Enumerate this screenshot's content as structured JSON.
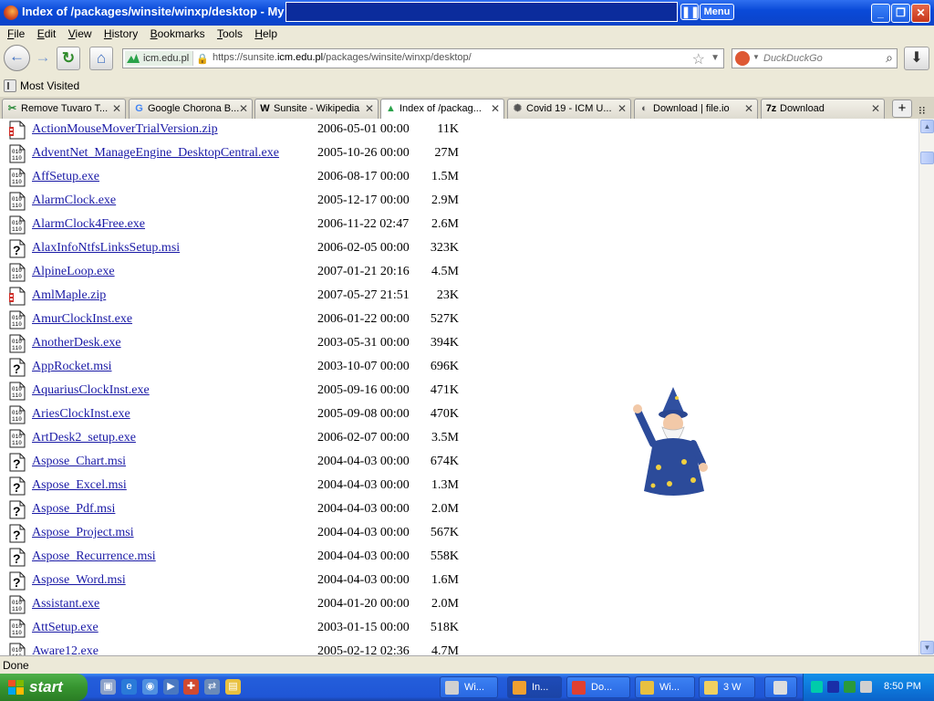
{
  "window": {
    "title": "Index of /packages/winsite/winxp/desktop - My",
    "pause_symbol": "❚❚",
    "menu_button": "Menu",
    "min": "_",
    "max": "❐",
    "close": "✕"
  },
  "menubar": [
    "File",
    "Edit",
    "View",
    "History",
    "Bookmarks",
    "Tools",
    "Help"
  ],
  "nav": {
    "back": "←",
    "forward": "→",
    "reload": "↻",
    "home": "⌂",
    "site_badge": "icm.edu.pl",
    "url_prefix": "https://sunsite.",
    "url_domain": "icm.edu.pl",
    "url_path": "/packages/winsite/winxp/desktop/",
    "search_placeholder": "DuckDuckGo",
    "download": "⬇"
  },
  "bookmarks": {
    "most_visited": "Most Visited"
  },
  "tabs": [
    {
      "label": "Remove Tuvaro T...",
      "icon": "tuvaro-icon",
      "icon_glyph": "✂",
      "icon_color": "#2a8a3a",
      "active": false
    },
    {
      "label": "Google Chorona B...",
      "icon": "google-icon",
      "icon_glyph": "G",
      "icon_color": "#4285f4",
      "active": false
    },
    {
      "label": "Sunsite - Wikipedia",
      "icon": "wikipedia-icon",
      "icon_glyph": "W",
      "icon_color": "#000000",
      "active": false
    },
    {
      "label": "Index of /packag...",
      "icon": "icm-icon",
      "icon_glyph": "▲",
      "icon_color": "#2aa24a",
      "active": true
    },
    {
      "label": "Covid 19 - ICM U...",
      "icon": "covid-icon",
      "icon_glyph": "✺",
      "icon_color": "#555555",
      "active": false
    },
    {
      "label": "Download | file.io",
      "icon": "fileio-icon",
      "icon_glyph": "◐",
      "icon_color": "#555555",
      "active": false
    },
    {
      "label": "Download",
      "icon": "7zip-icon",
      "icon_glyph": "7z",
      "icon_color": "#000000",
      "active": false
    }
  ],
  "new_tab": "+",
  "tab_menu": "⁝⁝",
  "files": [
    {
      "name": "ActionMouseMoverTrialVersion.zip",
      "date": "2006-05-01 00:00",
      "size": "11K",
      "type": "zip"
    },
    {
      "name": "AdventNet_ManageEngine_DesktopCentral.exe",
      "date": "2005-10-26 00:00",
      "size": "27M",
      "type": "exe"
    },
    {
      "name": "AffSetup.exe",
      "date": "2006-08-17 00:00",
      "size": "1.5M",
      "type": "exe"
    },
    {
      "name": "AlarmClock.exe",
      "date": "2005-12-17 00:00",
      "size": "2.9M",
      "type": "exe"
    },
    {
      "name": "AlarmClock4Free.exe",
      "date": "2006-11-22 02:47",
      "size": "2.6M",
      "type": "exe"
    },
    {
      "name": "AlaxInfoNtfsLinksSetup.msi",
      "date": "2006-02-05 00:00",
      "size": "323K",
      "type": "unknown"
    },
    {
      "name": "AlpineLoop.exe",
      "date": "2007-01-21 20:16",
      "size": "4.5M",
      "type": "exe"
    },
    {
      "name": "AmlMaple.zip",
      "date": "2007-05-27 21:51",
      "size": "23K",
      "type": "zip"
    },
    {
      "name": "AmurClockInst.exe",
      "date": "2006-01-22 00:00",
      "size": "527K",
      "type": "exe"
    },
    {
      "name": "AnotherDesk.exe",
      "date": "2003-05-31 00:00",
      "size": "394K",
      "type": "exe"
    },
    {
      "name": "AppRocket.msi",
      "date": "2003-10-07 00:00",
      "size": "696K",
      "type": "unknown"
    },
    {
      "name": "AquariusClockInst.exe",
      "date": "2005-09-16 00:00",
      "size": "471K",
      "type": "exe"
    },
    {
      "name": "AriesClockInst.exe",
      "date": "2005-09-08 00:00",
      "size": "470K",
      "type": "exe"
    },
    {
      "name": "ArtDesk2_setup.exe",
      "date": "2006-02-07 00:00",
      "size": "3.5M",
      "type": "exe"
    },
    {
      "name": "Aspose_Chart.msi",
      "date": "2004-04-03 00:00",
      "size": "674K",
      "type": "unknown"
    },
    {
      "name": "Aspose_Excel.msi",
      "date": "2004-04-03 00:00",
      "size": "1.3M",
      "type": "unknown"
    },
    {
      "name": "Aspose_Pdf.msi",
      "date": "2004-04-03 00:00",
      "size": "2.0M",
      "type": "unknown"
    },
    {
      "name": "Aspose_Project.msi",
      "date": "2004-04-03 00:00",
      "size": "567K",
      "type": "unknown"
    },
    {
      "name": "Aspose_Recurrence.msi",
      "date": "2004-04-03 00:00",
      "size": "558K",
      "type": "unknown"
    },
    {
      "name": "Aspose_Word.msi",
      "date": "2004-04-03 00:00",
      "size": "1.6M",
      "type": "unknown"
    },
    {
      "name": "Assistant.exe",
      "date": "2004-01-20 00:00",
      "size": "2.0M",
      "type": "exe"
    },
    {
      "name": "AttSetup.exe",
      "date": "2003-01-15 00:00",
      "size": "518K",
      "type": "exe"
    },
    {
      "name": "Aware12.exe",
      "date": "2005-02-12 02:36",
      "size": "4.7M",
      "type": "exe"
    }
  ],
  "status": "Done",
  "taskbar": {
    "start": "start",
    "tasks": [
      {
        "label": "Wi...",
        "icon_color": "#d0d0d0",
        "active": false
      },
      {
        "label": "In...",
        "icon_color": "#f0a030",
        "active": true
      },
      {
        "label": "Do...",
        "icon_color": "#e04030",
        "active": false
      },
      {
        "label": "Wi...",
        "icon_color": "#e8c040",
        "active": false
      },
      {
        "label": "3 W",
        "icon_color": "#f0d060",
        "active": false
      }
    ],
    "clock": "8:50 PM"
  }
}
